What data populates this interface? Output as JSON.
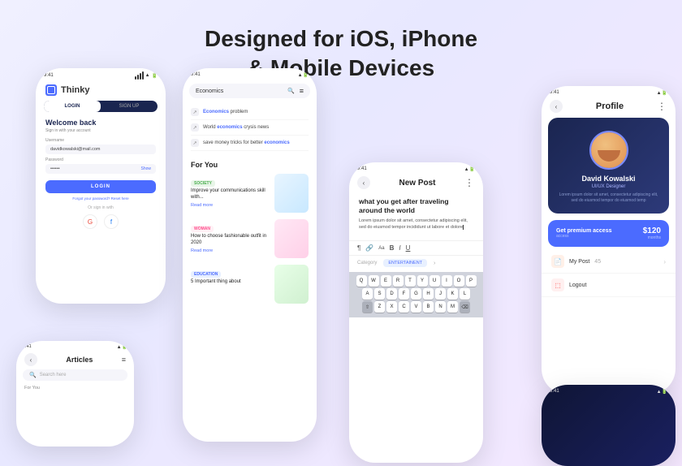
{
  "header": {
    "line1": "Designed for iOS, iPhone",
    "line2": "& Mobile Devices"
  },
  "phone_login": {
    "status_time": "9:41",
    "app_name": "Thinky",
    "tab_login": "LOGIN",
    "tab_signup": "SIGN UP",
    "welcome": "Welcome back",
    "subtitle": "Sign in with your account",
    "username_label": "Username",
    "username_value": "davidkowalski@mail.com",
    "password_label": "Password",
    "password_value": "••••••",
    "show_label": "Show",
    "login_btn": "LOGIN",
    "forgot_text": "Forgot your password?",
    "reset_label": "Reset here",
    "or_text": "Or sign in with"
  },
  "phone_articles": {
    "status_time": "9:41",
    "title": "Articles",
    "search_placeholder": "Search here",
    "for_you": "For You"
  },
  "phone_search": {
    "status_time": "9:41",
    "search_value": "Economics",
    "suggestions": [
      {
        "text": "Economics problem",
        "highlight": "Economics"
      },
      {
        "text": "World economics crysis news",
        "highlight": "economics"
      },
      {
        "text": "save money tricks for better economics",
        "highlight": "economics"
      }
    ],
    "for_you": "For You",
    "cards": [
      {
        "tag": "SOCIETY",
        "tag_type": "society",
        "title": "Improve your communications skill with...",
        "read_more": "Read more"
      },
      {
        "tag": "WOMAN",
        "tag_type": "woman",
        "title": "How to choose fashionable outfit in 2020",
        "read_more": "Read more"
      },
      {
        "tag": "EDUCATION",
        "tag_type": "education",
        "title": "5 Important thing about"
      }
    ]
  },
  "phone_newpost": {
    "status_time": "9:41",
    "title": "New Post",
    "heading": "what you get after traveling around the world",
    "body": "Lorem ipsum dolor sit amet, consectetur adipiscing elit, sed do eiusmod tempor incididunt ut labore et dolore",
    "category_label": "Category",
    "category_value": "ENTERTAINENT",
    "keyboard_rows": [
      [
        "Q",
        "W",
        "E",
        "R",
        "T",
        "Y",
        "U",
        "I",
        "O",
        "P"
      ],
      [
        "A",
        "S",
        "D",
        "F",
        "G",
        "H",
        "J",
        "K",
        "L"
      ],
      [
        "Z",
        "X",
        "C",
        "V",
        "B",
        "N",
        "M"
      ]
    ]
  },
  "phone_profile": {
    "status_time": "9:41",
    "title": "Profile",
    "name": "David Kowalski",
    "role": "UI/UX Designer",
    "bio": "Lorem ipsum dolor sit amet, consectetur adipiscing elit, sed do eiusmod tempor do eiusmod temp",
    "premium_label": "Get premium access",
    "price": "$120",
    "price_period": "months",
    "menu_items": [
      {
        "label": "My Post",
        "count": "45",
        "icon_type": "mypost"
      },
      {
        "label": "Logout",
        "count": "",
        "icon_type": "logout"
      }
    ]
  },
  "phone_dark": {
    "status_time": "9:41"
  },
  "icons": {
    "back_arrow": "‹",
    "three_dots": "⋮",
    "search": "🔍",
    "filter": "≡",
    "forward_arrow": "›",
    "paragraph": "¶",
    "link": "🔗",
    "font_aa": "Aa",
    "bold": "B",
    "italic": "I",
    "underline": "U"
  }
}
